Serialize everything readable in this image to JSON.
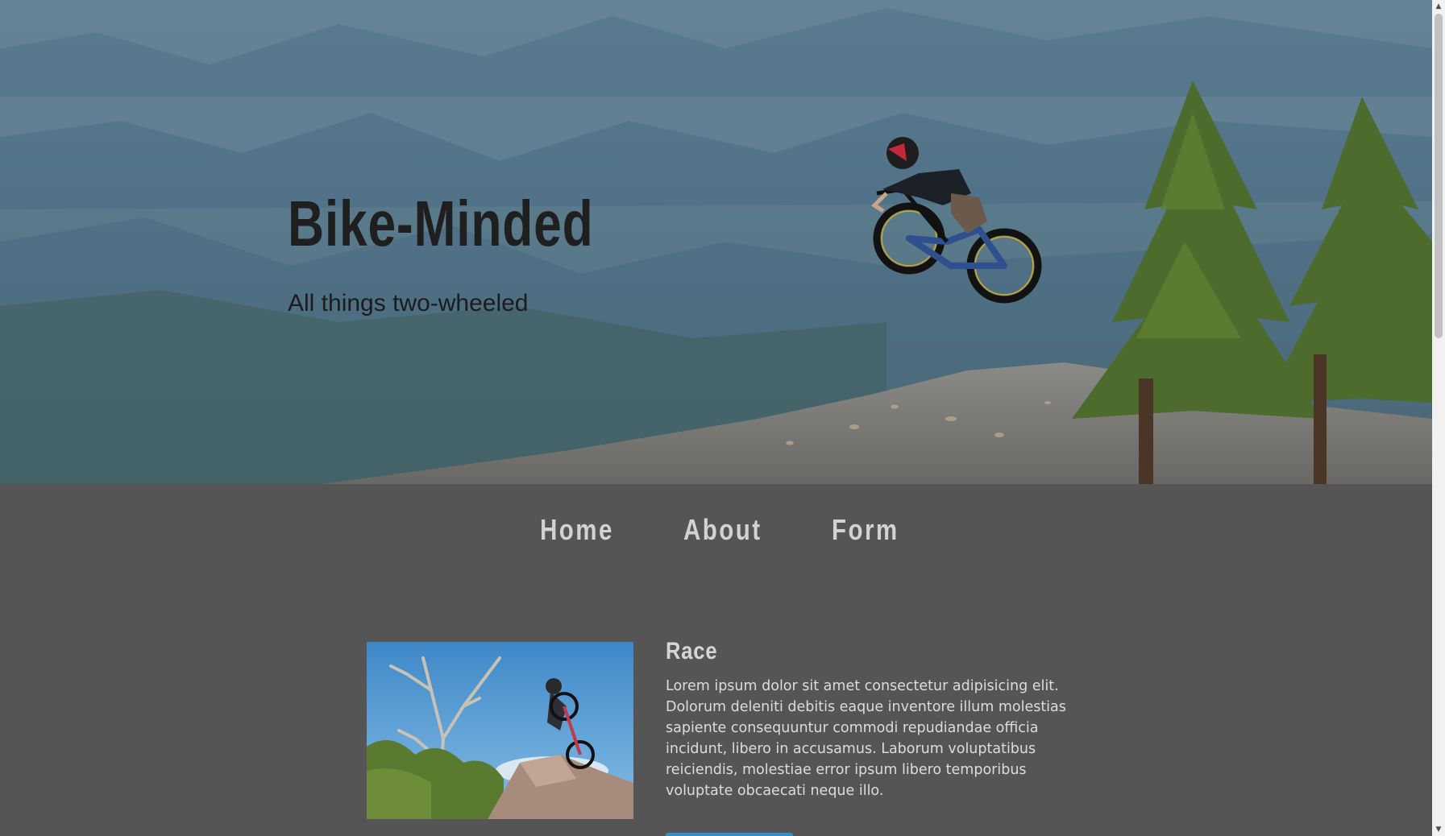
{
  "hero": {
    "title": "Bike-Minded",
    "subtitle": "All things two-wheeled",
    "image": "mountain-biker-jumping-over-cliff-with-pine-trees"
  },
  "nav": {
    "items": [
      {
        "label": "Home"
      },
      {
        "label": "About"
      },
      {
        "label": "Form"
      }
    ]
  },
  "card": {
    "image": "mountain-biker-airborne-over-rocks-with-dead-tree",
    "title": "Race",
    "text": "Lorem ipsum dolor sit amet consectetur adipisicing elit. Dolorum deleniti debitis eaque inventore illum molestias sapiente consequuntur commodi repudiandae officia incidunt, libero in accusamus. Laborum voluptatibus reiciendis, molestiae error ipsum libero temporibus voluptate obcaecati neque illo."
  },
  "colors": {
    "page_background": "#555555",
    "nav_text": "#d2d2d2",
    "hero_title": "#1f1f1f",
    "button_accent": "#2f8fd0"
  },
  "scrollbar": {
    "up_icon": "triangle-up-icon",
    "down_icon": "triangle-down-icon"
  }
}
